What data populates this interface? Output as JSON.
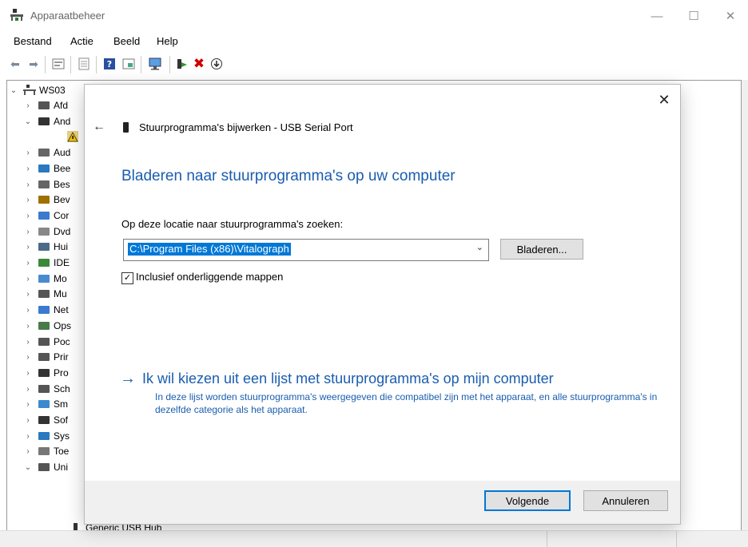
{
  "window": {
    "title": "Apparaatbeheer"
  },
  "menu": [
    "Bestand",
    "Actie",
    "Beeld",
    "Help"
  ],
  "tree": {
    "root": "WS03",
    "items": [
      {
        "label": "Afd",
        "expanded": false
      },
      {
        "label": "And",
        "expanded": true
      },
      {
        "label": "",
        "expanded": null
      },
      {
        "label": "Aud",
        "expanded": false
      },
      {
        "label": "Bee",
        "expanded": false
      },
      {
        "label": "Bes",
        "expanded": false
      },
      {
        "label": "Bev",
        "expanded": false
      },
      {
        "label": "Cor",
        "expanded": false
      },
      {
        "label": "Dvd",
        "expanded": false
      },
      {
        "label": "Hui",
        "expanded": false
      },
      {
        "label": "IDE",
        "expanded": false
      },
      {
        "label": "Mo",
        "expanded": false
      },
      {
        "label": "Mu",
        "expanded": false
      },
      {
        "label": "Net",
        "expanded": false
      },
      {
        "label": "Ops",
        "expanded": false
      },
      {
        "label": "Poc",
        "expanded": false
      },
      {
        "label": "Prir",
        "expanded": false
      },
      {
        "label": "Pro",
        "expanded": false
      },
      {
        "label": "Sch",
        "expanded": false
      },
      {
        "label": "Sm",
        "expanded": false
      },
      {
        "label": "Sof",
        "expanded": false
      },
      {
        "label": "Sys",
        "expanded": false
      },
      {
        "label": "Toe",
        "expanded": false
      },
      {
        "label": "Uni",
        "expanded": true
      }
    ],
    "child_under_uni": "Generic USB Hub"
  },
  "dialog": {
    "header": "Stuurprogramma's bijwerken - USB Serial Port",
    "title": "Bladeren naar stuurprogramma's op uw computer",
    "location_label": "Op deze locatie naar stuurprogramma's zoeken:",
    "path_value": "C:\\Program Files (x86)\\Vitalograph",
    "browse_label": "Bladeren...",
    "include_subfolders_label": "Inclusief onderliggende mappen",
    "include_subfolders_checked": true,
    "choose_link": "Ik wil kiezen uit een lijst met stuurprogramma's op mijn computer",
    "choose_desc": "In deze lijst worden stuurprogramma's weergegeven die compatibel zijn met het apparaat, en alle stuurprogramma's in dezelfde categorie als het apparaat.",
    "next_label": "Volgende",
    "cancel_label": "Annuleren"
  },
  "colors": {
    "accent": "#0078d7",
    "link": "#1a5db0",
    "delete": "#d00000"
  }
}
